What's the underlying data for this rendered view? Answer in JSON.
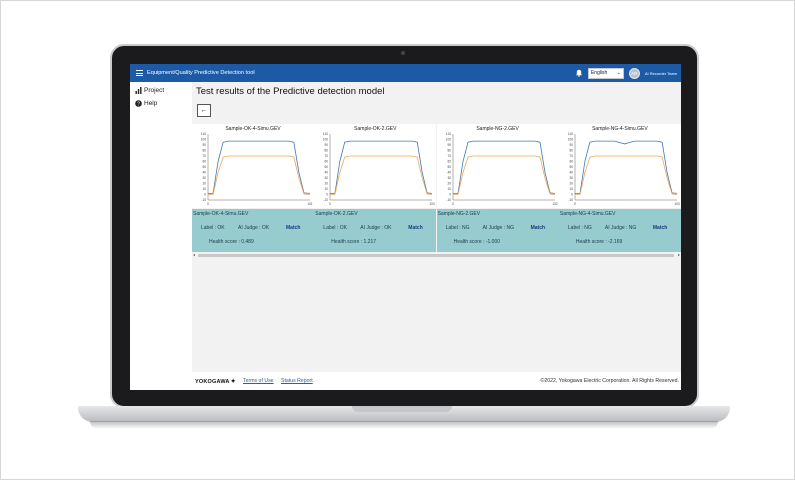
{
  "header": {
    "app_title": "Equipment/Quality Predictive Detection tool",
    "language": "English",
    "avatar_initials": "AR",
    "user_name": "AI Recorder Team",
    "color": "#1d5aa6"
  },
  "sidebar": {
    "items": [
      {
        "label": "Project",
        "icon": "bar-chart-icon"
      },
      {
        "label": "Help",
        "icon": "help-circle-icon"
      }
    ]
  },
  "main": {
    "title": "Test results of the Predictive detection model",
    "back_label": "←"
  },
  "results": [
    {
      "file": "Sample-OK-4-Simu.GEV",
      "label_text": "Label : OK",
      "ai_text": "AI Judge : OK",
      "match": "Match",
      "score_text": "Health score : 0.489",
      "chart_data": {
        "type": "line",
        "title": "Sample-OK-4-Simu.GEV",
        "yticks": [
          "110",
          "100",
          "90",
          "80",
          "70",
          "60",
          "50",
          "40",
          "30",
          "20",
          "10",
          "0",
          "-10"
        ],
        "xticks": [
          "0",
          "101"
        ],
        "ylim": [
          -10,
          110
        ],
        "xlim": [
          0,
          101
        ],
        "series": [
          {
            "color": "#3f79b8",
            "x": [
              0,
              5,
              10,
              15,
              20,
              80,
              85,
              90,
              95,
              101
            ],
            "y": [
              2,
              2,
              60,
              95,
              97,
              97,
              95,
              40,
              3,
              2
            ]
          },
          {
            "color": "#f2a65a",
            "x": [
              0,
              5,
              10,
              15,
              20,
              80,
              85,
              90,
              95,
              101
            ],
            "y": [
              0,
              0,
              40,
              68,
              70,
              70,
              68,
              30,
              1,
              0
            ]
          }
        ]
      }
    },
    {
      "file": "Sample-OK-2.GEV",
      "label_text": "Label : OK",
      "ai_text": "AI Judge : OK",
      "match": "Match",
      "score_text": "Health score : 1.217",
      "chart_data": {
        "type": "line",
        "title": "Sample-OK-2.GEV",
        "yticks": [
          "110",
          "100",
          "90",
          "80",
          "70",
          "60",
          "50",
          "40",
          "30",
          "20",
          "10",
          "0",
          "-10"
        ],
        "xticks": [
          "0",
          "104"
        ],
        "ylim": [
          -10,
          110
        ],
        "xlim": [
          0,
          104
        ],
        "series": [
          {
            "color": "#3f79b8",
            "x": [
              0,
              5,
              10,
              15,
              20,
              84,
              89,
              94,
              99,
              104
            ],
            "y": [
              2,
              2,
              60,
              95,
              97,
              97,
              95,
              40,
              3,
              2
            ]
          },
          {
            "color": "#f2a65a",
            "x": [
              0,
              5,
              10,
              15,
              20,
              84,
              89,
              94,
              99,
              104
            ],
            "y": [
              0,
              0,
              40,
              68,
              70,
              70,
              68,
              30,
              1,
              0
            ]
          }
        ]
      }
    },
    {
      "file": "Sample-NG-2.GEV",
      "label_text": "Label : NG",
      "ai_text": "AI Judge : NG",
      "match": "Match",
      "score_text": "Health score : -1.000",
      "chart_data": {
        "type": "line",
        "title": "Sample-NG-2.GEV",
        "yticks": [
          "110",
          "100",
          "90",
          "80",
          "70",
          "60",
          "50",
          "40",
          "30",
          "20",
          "10",
          "0",
          "-10"
        ],
        "xticks": [
          "0",
          "102"
        ],
        "ylim": [
          -10,
          110
        ],
        "xlim": [
          0,
          102
        ],
        "series": [
          {
            "color": "#3f79b8",
            "x": [
              0,
              5,
              10,
              15,
              20,
              82,
              87,
              92,
              97,
              102
            ],
            "y": [
              2,
              2,
              60,
              95,
              97,
              97,
              95,
              40,
              3,
              2
            ]
          },
          {
            "color": "#f2a65a",
            "x": [
              0,
              5,
              10,
              15,
              20,
              82,
              87,
              92,
              97,
              102
            ],
            "y": [
              0,
              0,
              40,
              68,
              70,
              70,
              68,
              30,
              1,
              0
            ]
          }
        ]
      }
    },
    {
      "file": "Sample-NG-4-Simu.GEV",
      "label_text": "Label : NG",
      "ai_text": "AI Judge : NG",
      "match": "Match",
      "score_text": "Health score : -2.169",
      "chart_data": {
        "type": "line",
        "title": "Sample-NG-4-Simu.GEV",
        "yticks": [
          "110",
          "100",
          "90",
          "80",
          "70",
          "60",
          "50",
          "40",
          "30",
          "20",
          "10",
          "0",
          "-10"
        ],
        "xticks": [
          "0",
          "103"
        ],
        "ylim": [
          -10,
          110
        ],
        "xlim": [
          0,
          103
        ],
        "series": [
          {
            "color": "#3f79b8",
            "x": [
              0,
              5,
              10,
              15,
              20,
              40,
              50,
              60,
              83,
              88,
              93,
              98,
              103
            ],
            "y": [
              2,
              2,
              60,
              95,
              97,
              97,
              92,
              97,
              97,
              95,
              40,
              3,
              2
            ]
          },
          {
            "color": "#f2a65a",
            "x": [
              0,
              5,
              10,
              15,
              20,
              83,
              88,
              93,
              98,
              103
            ],
            "y": [
              0,
              0,
              40,
              68,
              70,
              70,
              68,
              30,
              1,
              0
            ]
          }
        ]
      }
    }
  ],
  "footer": {
    "logo": "YOKOGAWA",
    "terms": "Terms of Use",
    "status": "Status Report",
    "copyright": "©2022, Yokogawa Electric Corporation. All Rights Reserved."
  }
}
